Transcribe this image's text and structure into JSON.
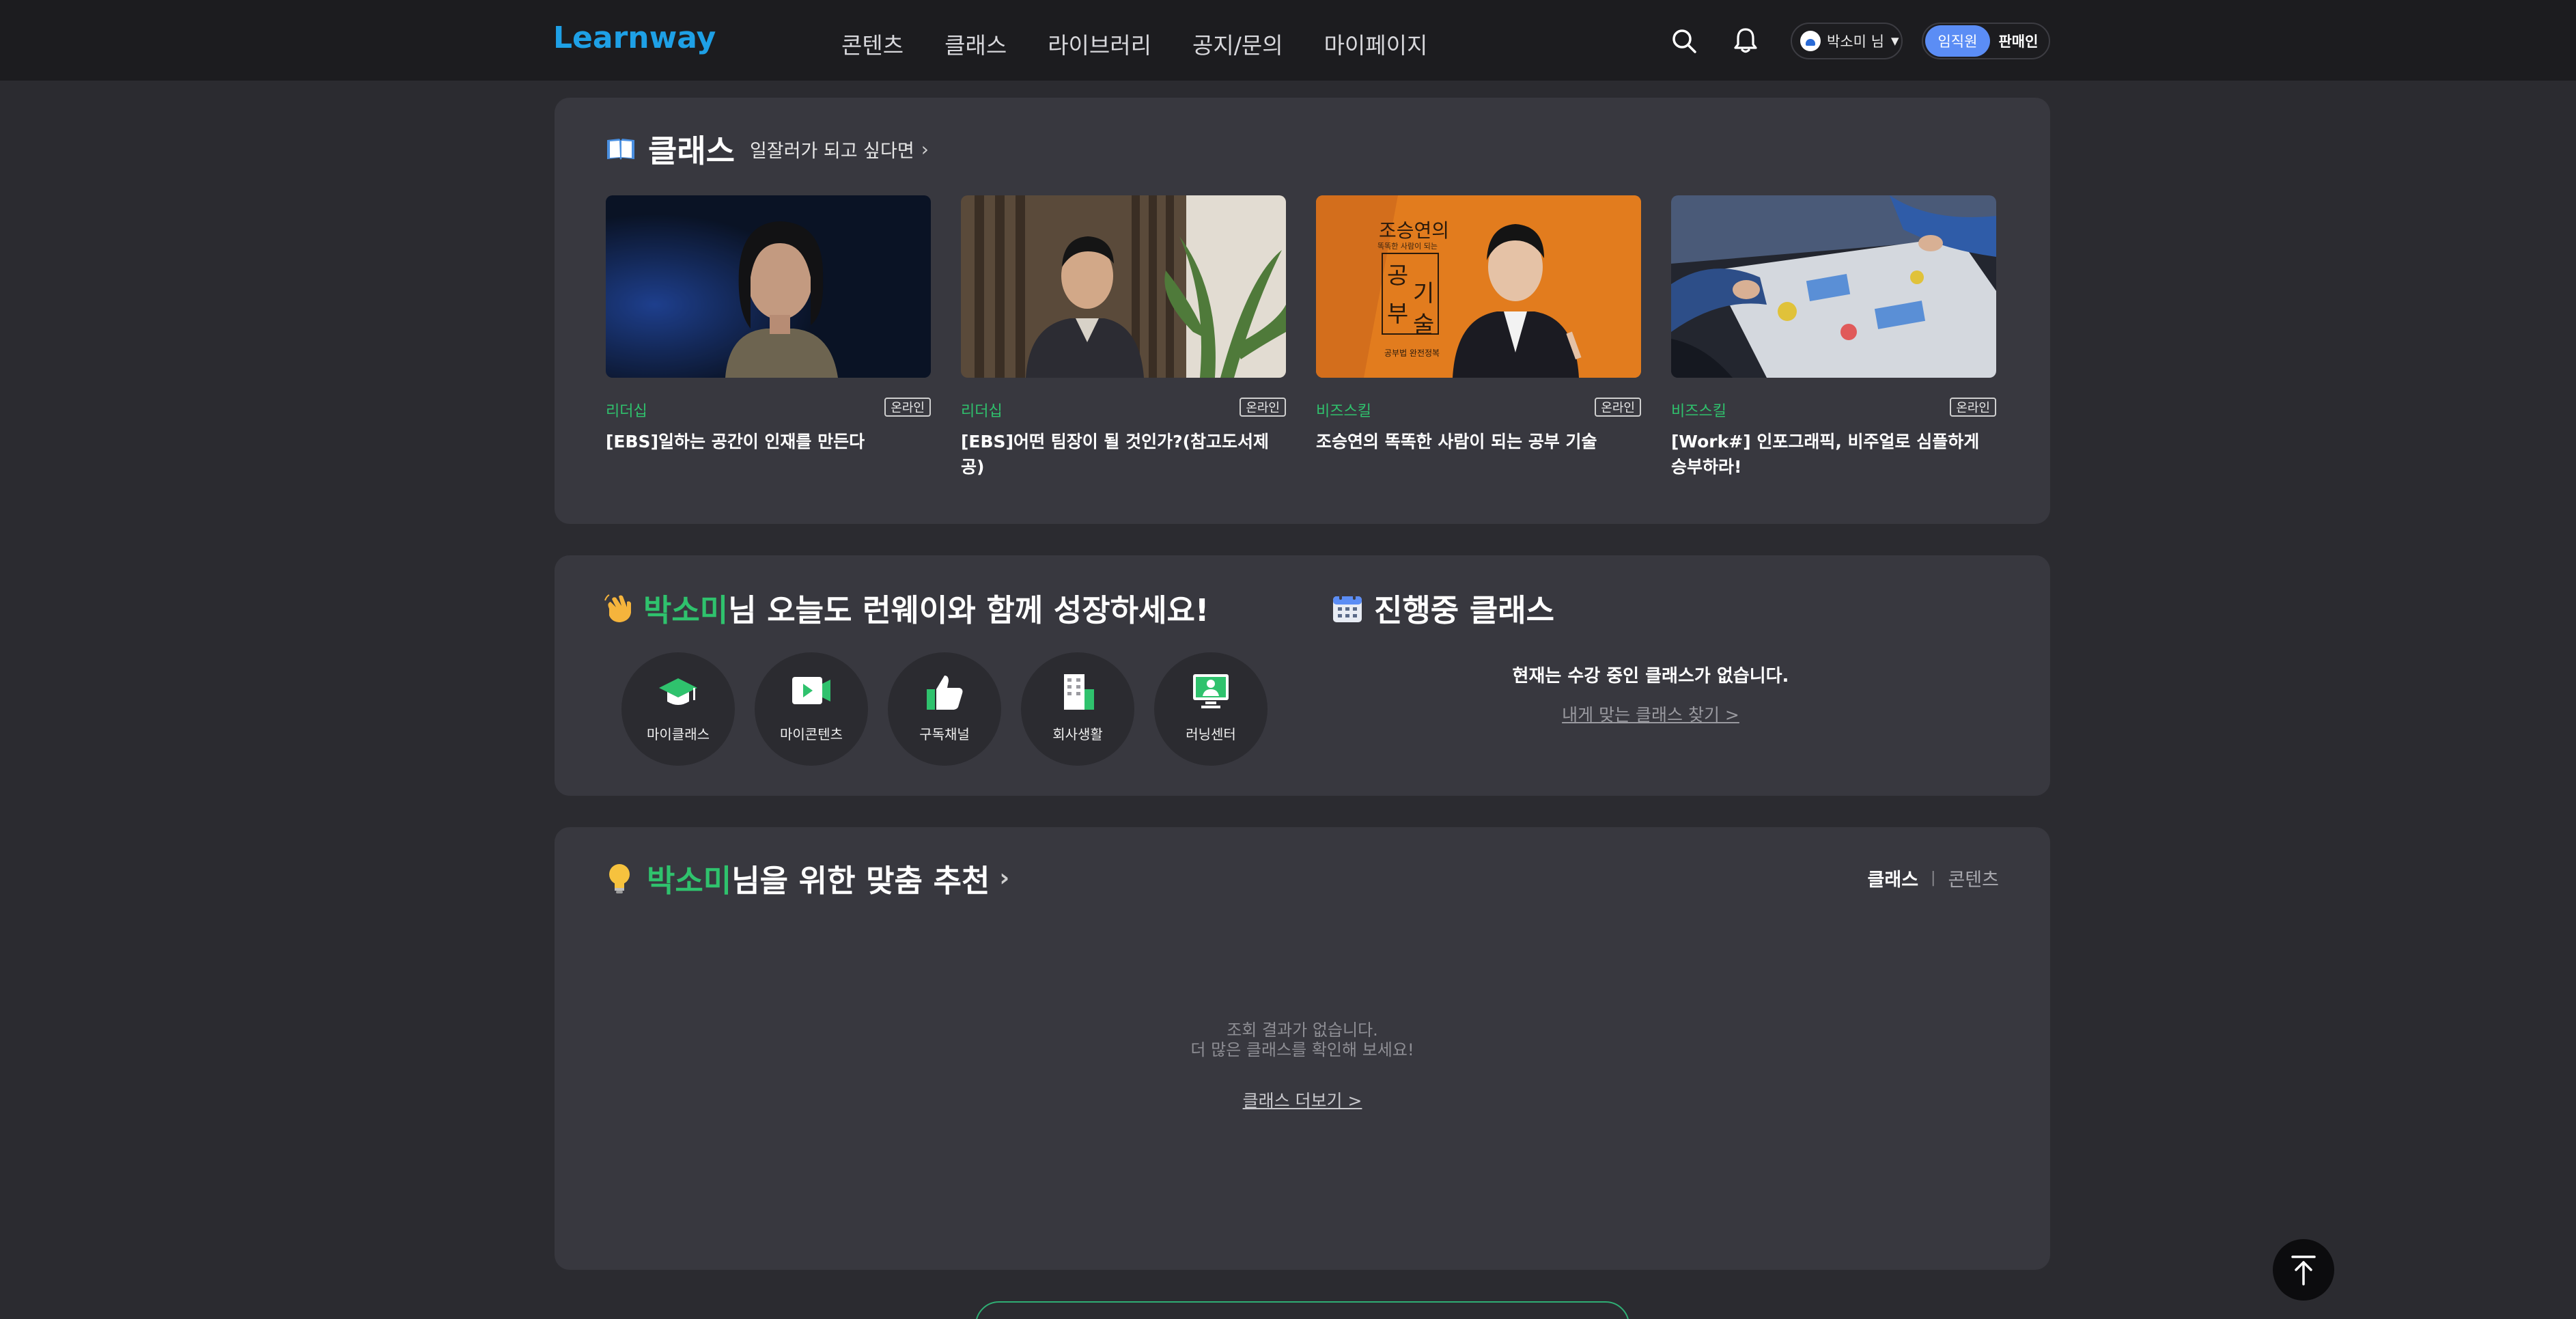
{
  "header": {
    "logo": "Learnway",
    "nav": [
      "콘텐츠",
      "클래스",
      "라이브러리",
      "공지/문의",
      "마이페이지"
    ],
    "icons": {
      "search": "search-icon",
      "notifications": "bell-icon"
    },
    "user": {
      "name": "박소미 님"
    },
    "mode": {
      "active": "임직원",
      "inactive": "판매인"
    }
  },
  "class_section": {
    "title": "클래스",
    "subtitle": "일잘러가 되고 싶다면",
    "cards": [
      {
        "category": "리더십",
        "badge": "온라인",
        "title": "[EBS]일하는 공간이 인재를 만든다"
      },
      {
        "category": "리더십",
        "badge": "온라인",
        "title": "[EBS]어떤 팀장이 될 것인가?(참고도서제공)"
      },
      {
        "category": "비즈스킬",
        "badge": "온라인",
        "title": "조승연의 똑똑한 사람이 되는 공부 기술",
        "thumb_text": {
          "top": "조승연의",
          "small": "똑똑한 사람이 되는",
          "main": [
            "공",
            "부",
            "기",
            "술"
          ],
          "bottom": "공부법 완전정복"
        }
      },
      {
        "category": "비즈스킬",
        "badge": "온라인",
        "title": "[Work#] 인포그래픽, 비주얼로 심플하게 승부하라!"
      }
    ]
  },
  "greeting": {
    "name": "박소미",
    "message": "님 오늘도 런웨이와 함께 성장하세요!",
    "quick_links": [
      "마이클래스",
      "마이콘텐츠",
      "구독채널",
      "회사생활",
      "러닝센터"
    ]
  },
  "in_progress": {
    "title": "진행중 클래스",
    "empty_message": "현재는 수강 중인 클래스가 없습니다.",
    "link": "내게 맞는 클래스 찾기 >"
  },
  "recommend": {
    "name": "박소미",
    "title_suffix": "님을 위한 맞춤 추천",
    "tabs": [
      "클래스",
      "콘텐츠"
    ],
    "no_result_line1": "조회 결과가 없습니다.",
    "no_result_line2": "더 많은 클래스를 확인해 보세요!",
    "more_link": "클래스 더보기 >"
  },
  "colors": {
    "accent_green": "#2fc26d",
    "logo_blue": "#1ea0e6",
    "toggle_blue": "#5b8df5"
  }
}
